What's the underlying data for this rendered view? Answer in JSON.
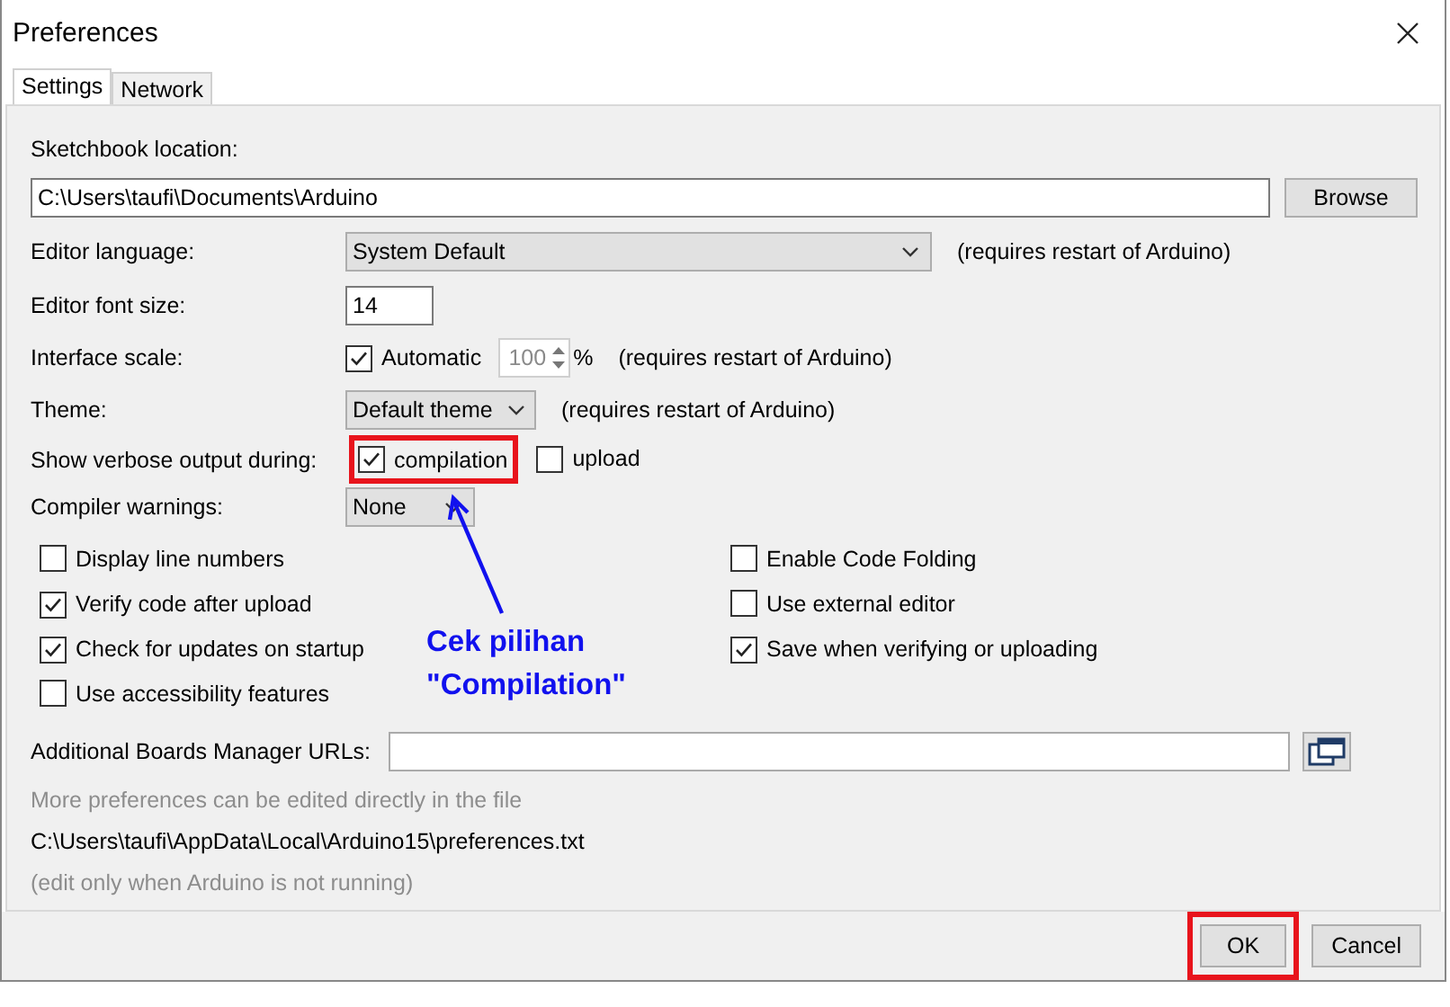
{
  "window": {
    "title": "Preferences"
  },
  "tabs": [
    {
      "label": "Settings",
      "selected": true
    },
    {
      "label": "Network",
      "selected": false
    }
  ],
  "sketchbook": {
    "label": "Sketchbook location:",
    "value": "C:\\Users\\taufi\\Documents\\Arduino",
    "button": "Browse"
  },
  "settings": [
    {
      "kind": "select",
      "label": "Editor language:",
      "value": "System Default",
      "note": "(requires restart of Arduino)"
    },
    {
      "kind": "text",
      "label": "Editor font size:",
      "value": "14"
    },
    {
      "kind": "scale",
      "label": "Interface scale:",
      "option": {
        "label": "Automatic",
        "checked": true
      },
      "value": "100",
      "unit": "%",
      "disabled": true,
      "note": "(requires restart of Arduino)"
    },
    {
      "kind": "select",
      "label": "Theme:",
      "value": "Default theme",
      "note": "(requires restart of Arduino)"
    },
    {
      "kind": "checks",
      "label": "Show verbose output during:",
      "options": [
        {
          "label": "compilation",
          "checked": true,
          "highlighted": true
        },
        {
          "label": "upload",
          "checked": false
        }
      ]
    },
    {
      "kind": "select",
      "label": "Compiler warnings:",
      "value": "None"
    }
  ],
  "left_options": [
    {
      "label": "Display line numbers",
      "checked": false
    },
    {
      "label": "Verify code after upload",
      "checked": true
    },
    {
      "label": "Check for updates on startup",
      "checked": true
    },
    {
      "label": "Use accessibility features",
      "checked": false
    }
  ],
  "right_options": [
    {
      "label": "Enable Code Folding",
      "checked": false
    },
    {
      "label": "Use external editor",
      "checked": false
    },
    {
      "label": "Save when verifying or uploading",
      "checked": true
    }
  ],
  "boards": {
    "label": "Additional Boards Manager URLs:"
  },
  "info": [
    {
      "text": "More preferences can be edited directly in the file",
      "muted": true
    },
    {
      "text": "C:\\Users\\taufi\\AppData\\Local\\Arduino15\\preferences.txt",
      "muted": false
    },
    {
      "text": "(edit only when Arduino is not running)",
      "muted": true
    }
  ],
  "buttons": [
    {
      "label": "OK",
      "highlighted": true
    },
    {
      "label": "Cancel"
    }
  ],
  "annotation": {
    "lines": [
      "Cek pilihan",
      "\"Compilation\""
    ]
  }
}
